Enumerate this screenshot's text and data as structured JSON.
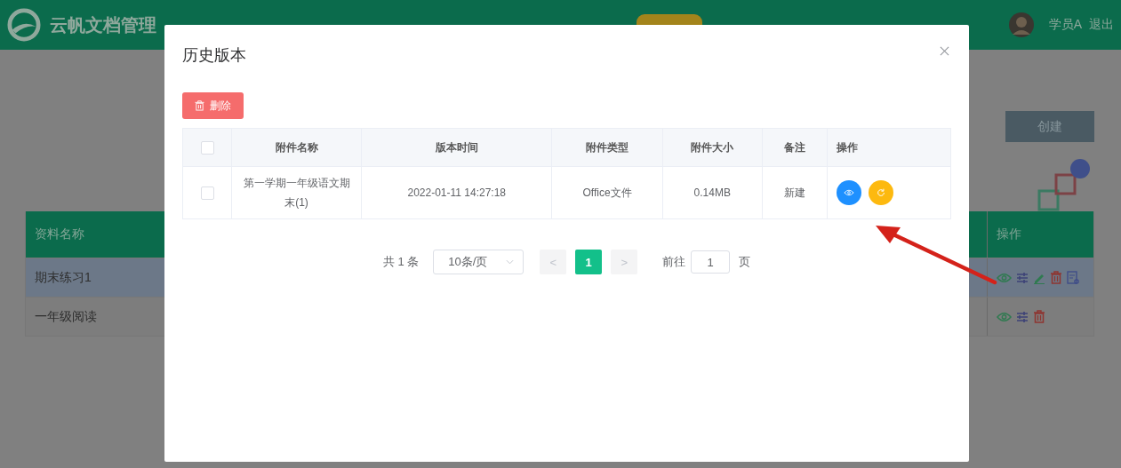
{
  "header": {
    "logo_text": "云帆文档管理",
    "user": "学员A",
    "logout": "退出"
  },
  "page": {
    "create_button": "创建",
    "table": {
      "columns": [
        "资料名称",
        "操作"
      ],
      "rows": [
        {
          "name": "期末练习1",
          "selected": true,
          "actions": [
            {
              "kind": "view"
            },
            {
              "kind": "adjust"
            },
            {
              "kind": "edit"
            },
            {
              "kind": "delete"
            },
            {
              "kind": "detail"
            }
          ]
        },
        {
          "name": "一年级阅读",
          "selected": false,
          "actions": [
            {
              "kind": "view"
            },
            {
              "kind": "adjust"
            },
            {
              "kind": "delete"
            }
          ]
        }
      ]
    }
  },
  "dialog": {
    "title": "历史版本",
    "delete_button": "删除",
    "table": {
      "all_checked": false,
      "columns": [
        "附件名称",
        "版本时间",
        "附件类型",
        "附件大小",
        "备注",
        "操作"
      ],
      "rows": [
        {
          "checked": false,
          "name": "第一学期一年级语文期末(1)",
          "time": "2022-01-11 14:27:18",
          "type": "Office文件",
          "size": "0.14MB",
          "note": "新建",
          "actions": [
            {
              "kind": "view"
            },
            {
              "kind": "restore"
            }
          ]
        }
      ]
    },
    "pagination": {
      "total": "共 1 条",
      "page_size": "10条/页",
      "prev": "<",
      "next": ">",
      "pages": [
        {
          "label": "1",
          "selected": true
        }
      ],
      "goto_label": "前往",
      "goto_value": "1",
      "goto_suffix": "页"
    }
  }
}
